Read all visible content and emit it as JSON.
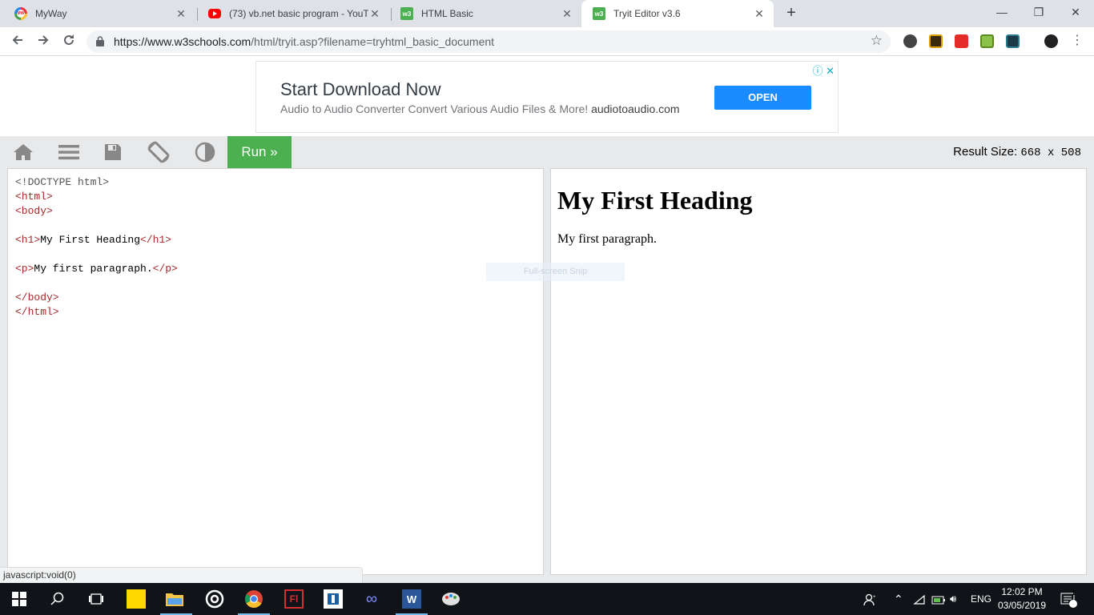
{
  "browser": {
    "tabs": [
      {
        "title": "MyWay",
        "favicon": "myway-icon"
      },
      {
        "title": "(73) vb.net basic program - YouT",
        "favicon": "youtube-icon"
      },
      {
        "title": "HTML Basic",
        "favicon": "w3schools-icon"
      },
      {
        "title": "Tryit Editor v3.6",
        "favicon": "w3schools-icon",
        "active": true
      }
    ],
    "url_host": "https://www.w3schools.com",
    "url_path": "/html/tryit.asp?filename=tryhtml_basic_document"
  },
  "ad": {
    "title": "Start Download Now",
    "description": "Audio to Audio Converter Convert Various Audio Files & More!",
    "domain": "audiotoaudio.com",
    "button": "OPEN"
  },
  "tryit": {
    "run_label": "Run »",
    "result_size_label": "Result Size:",
    "result_size_value": "668 x 508"
  },
  "code": {
    "doctype": "<!DOCTYPE html>",
    "heading_text": "My First Heading",
    "paragraph_text": "My first paragraph."
  },
  "result": {
    "heading": "My First Heading",
    "paragraph": "My first paragraph."
  },
  "overlay": {
    "snip_text": "Full-screen Snip",
    "status_link": "javascript:void(0)"
  },
  "system": {
    "language": "ENG",
    "time": "12:02 PM",
    "date": "03/05/2019",
    "notification_count": "1"
  },
  "colors": {
    "run_green": "#4caf50",
    "ad_button": "#1a8cff",
    "taskbar": "#101418"
  }
}
